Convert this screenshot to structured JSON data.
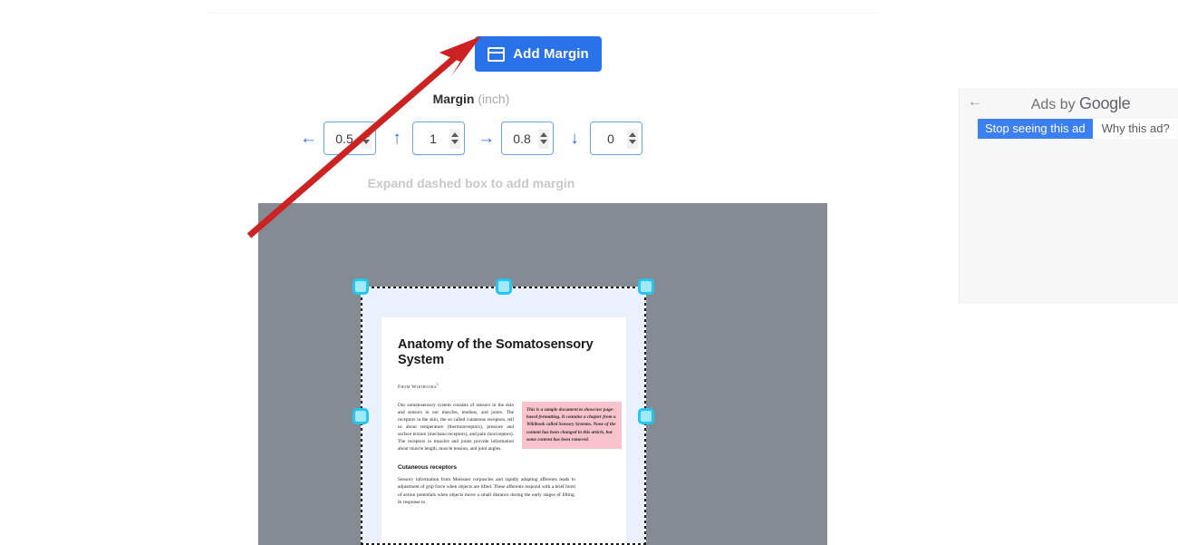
{
  "toolbar": {
    "add_margin_label": "Add Margin",
    "add_margin_icon": "margin-page-icon",
    "accent_color": "#2a72ea"
  },
  "margin_panel": {
    "heading": "Margin",
    "unit": "(inch)",
    "hint": "Expand dashed box to add margin",
    "fields": [
      {
        "direction": "left",
        "arrow": "←",
        "value": "0.5"
      },
      {
        "direction": "top",
        "arrow": "↑",
        "value": "1"
      },
      {
        "direction": "right",
        "arrow": "→",
        "value": "0.8"
      },
      {
        "direction": "bottom",
        "arrow": "↓",
        "value": "0"
      }
    ]
  },
  "canvas": {
    "background_color": "#848b95",
    "margin_region_color": "#eaf0fc",
    "handle_color": "#23c6ee",
    "handles": [
      "top-left",
      "top-center",
      "top-right",
      "middle-left",
      "middle-right"
    ]
  },
  "document": {
    "title": "Anatomy of the Somatosensory System",
    "source": "From Wikibooks",
    "source_footnote": "1",
    "paragraph_1": "Our somatosensory system consists of sensors in the skin and sensors in our muscles, tendons, and joints. The receptors in the skin, the so called cutaneous receptors, tell us about temperature (thermoreceptors), pressure and surface texture (mechano receptors), and pain (nociceptors). The receptors in muscles and joints provide information about muscle length, muscle tension, and joint angles.",
    "note": "This is a sample document to showcase page-based formatting. It contains a chapter from a Wikibook called Sensory Systems. None of the content has been changed in this article, but some content has been removed.",
    "section_heading": "Cutaneous receptors",
    "paragraph_2": "Sensory information from Meissner corpuscles and rapidly adapting afferents leads to adjustment of grip force when objects are lifted. These afferents respond with a brief burst of action potentials when objects move a small distance during the early stages of lifting. In response to"
  },
  "ad_panel": {
    "back_icon": "back-arrow-icon",
    "title_prefix": "Ads by ",
    "title_brand": "Google",
    "stop_button": "Stop seeing this ad",
    "why_button": "Why this ad?",
    "primary_color": "#3b7ff0"
  },
  "annotation": {
    "arrow_color": "#cc2222",
    "points_to": "add-margin-button"
  }
}
